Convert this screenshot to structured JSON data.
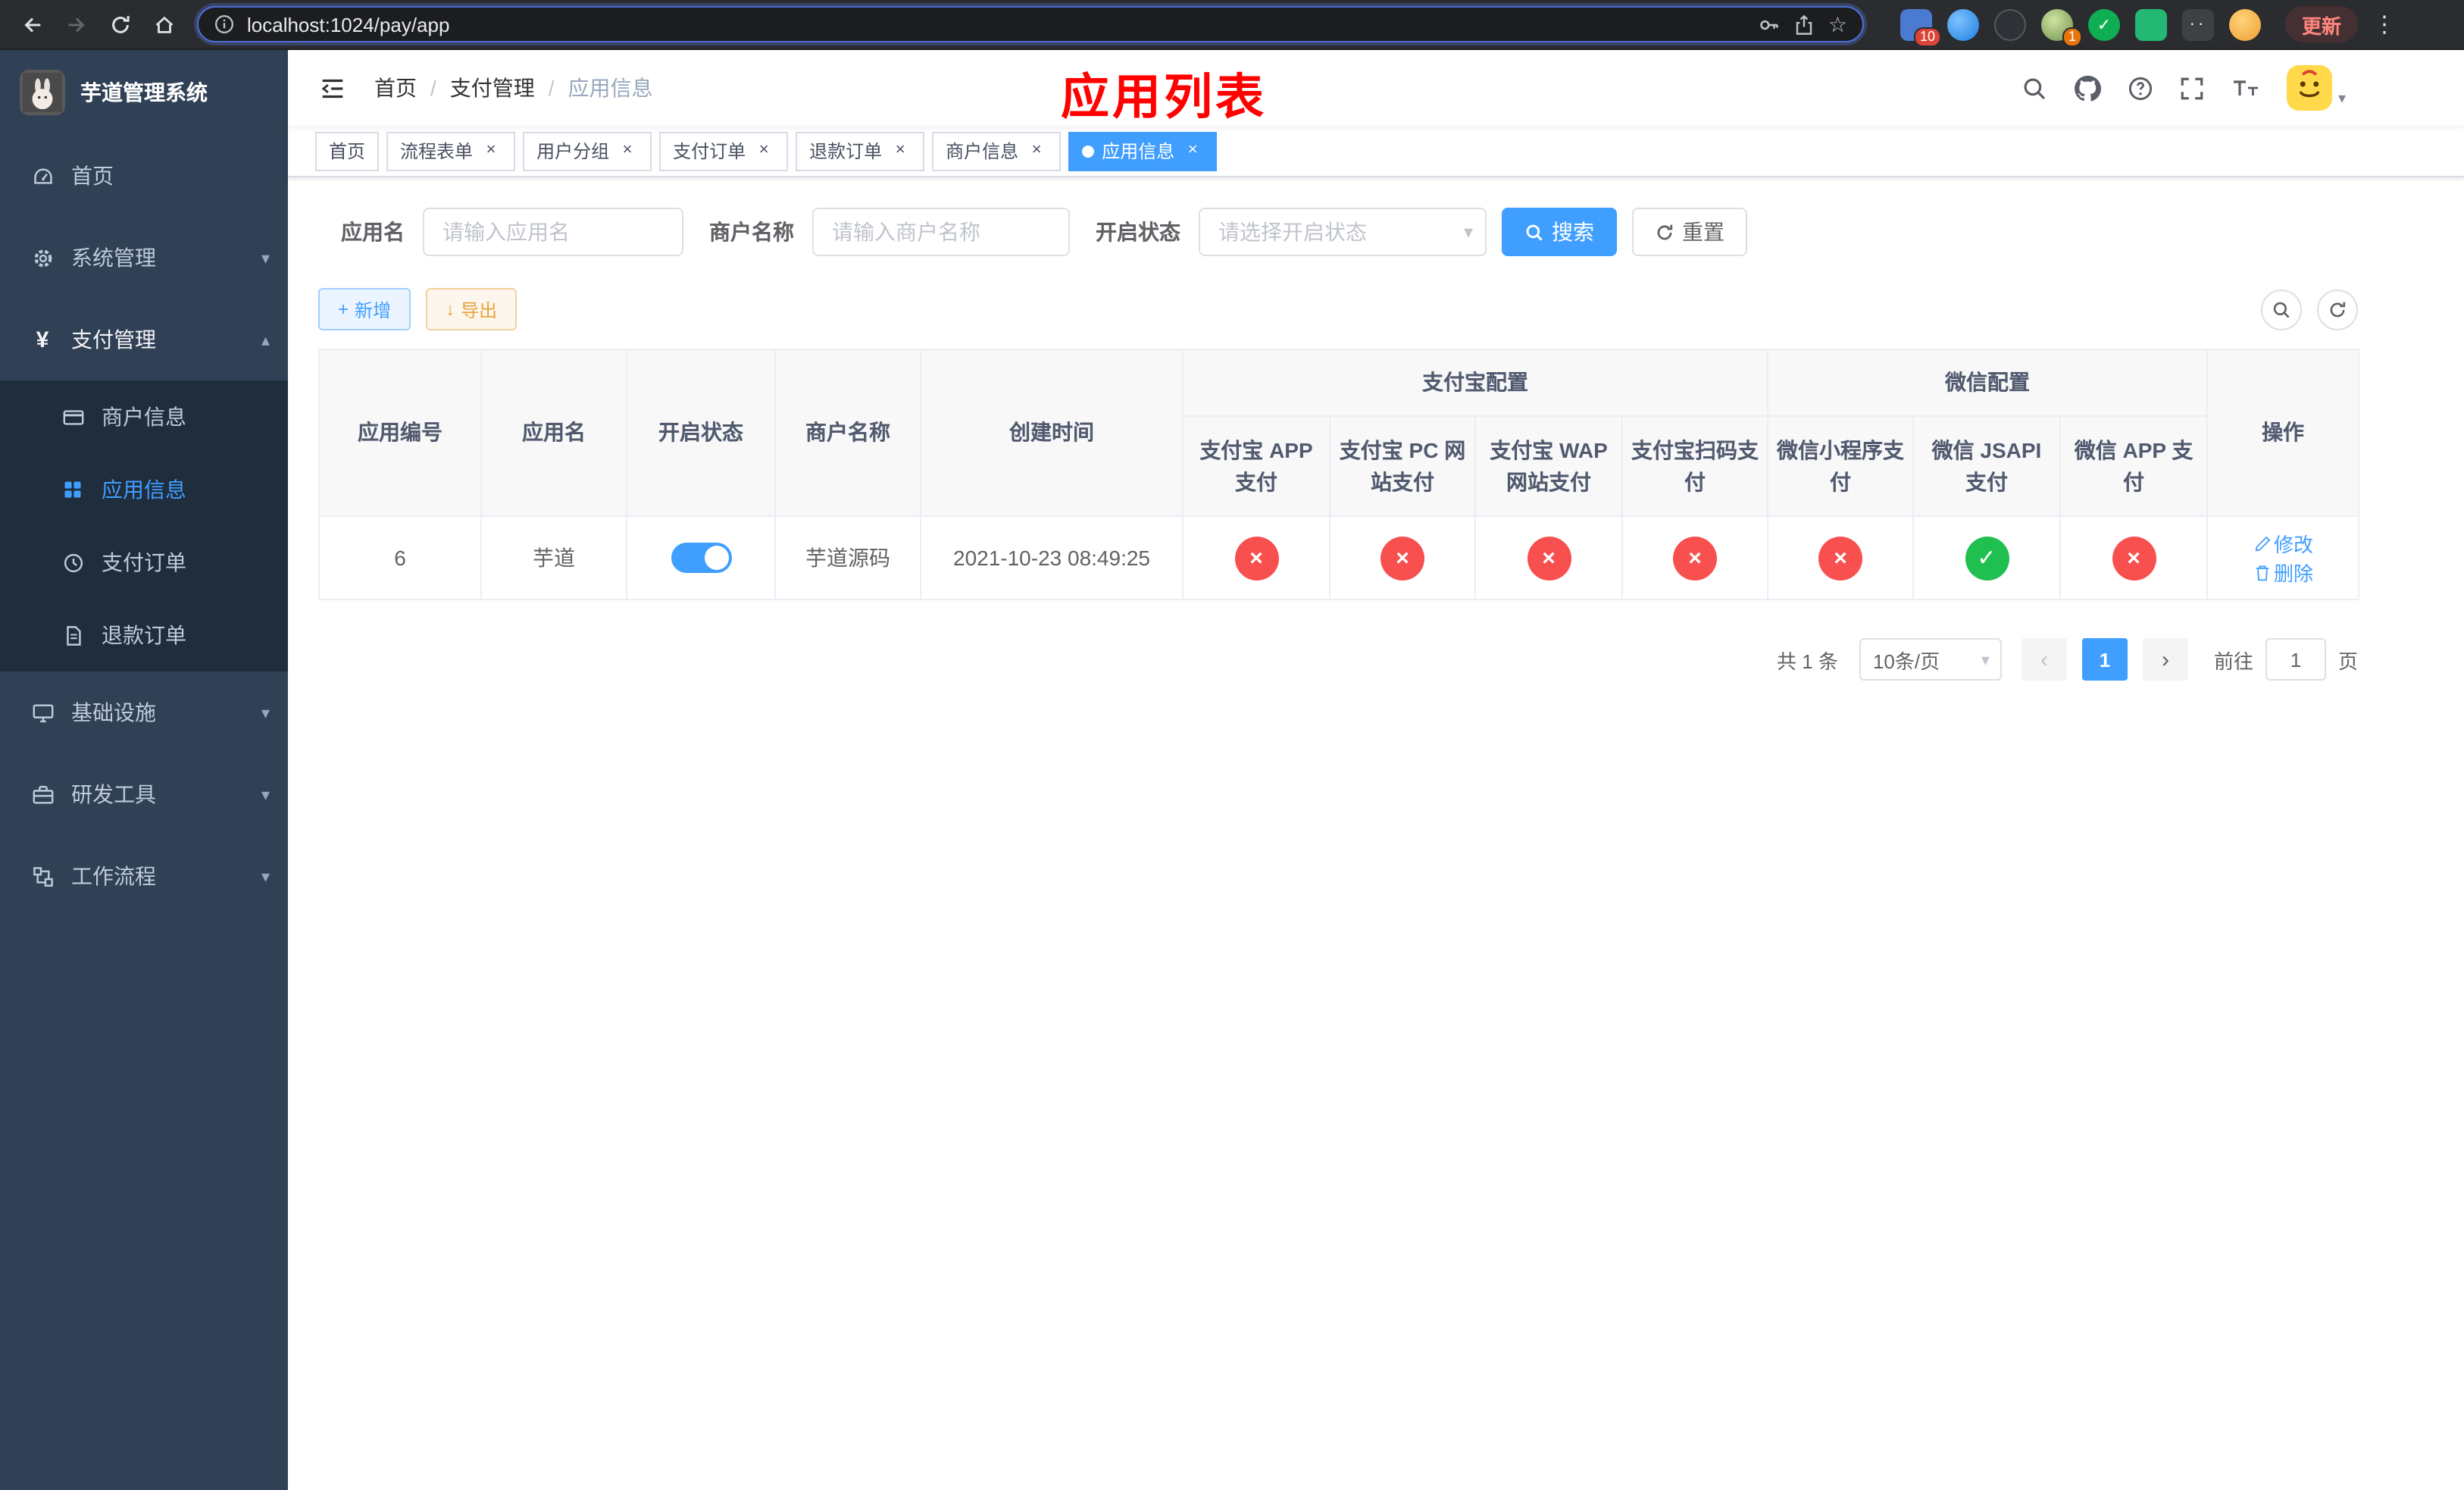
{
  "browser": {
    "url": "localhost:1024/pay/app",
    "update_label": "更新",
    "ext_badge_1": "10",
    "ext_badge_avatar": "1"
  },
  "icons": {
    "back": "←",
    "forward": "→",
    "star": "☆",
    "menu_dots": "⋮",
    "caret_down": "▾",
    "caret_up": "▴",
    "yen": "¥",
    "plus": "+",
    "download": "↓",
    "check": "✓",
    "cross": "×",
    "page_prev": "‹",
    "page_next": "›",
    "ext_check": "✓",
    "ext_eyes": "··"
  },
  "sidebar": {
    "app_title": "芋道管理系统",
    "items": {
      "home": "首页",
      "system": "系统管理",
      "payment": "支付管理",
      "merchant": "商户信息",
      "app_info": "应用信息",
      "pay_order": "支付订单",
      "refund_order": "退款订单",
      "infra": "基础设施",
      "dev_tools": "研发工具",
      "workflow": "工作流程"
    }
  },
  "header": {
    "breadcrumb": [
      "首页",
      "支付管理",
      "应用信息"
    ],
    "annotation": "应用列表"
  },
  "tabs": [
    {
      "label": "首页"
    },
    {
      "label": "流程表单"
    },
    {
      "label": "用户分组"
    },
    {
      "label": "支付订单"
    },
    {
      "label": "退款订单"
    },
    {
      "label": "商户信息"
    },
    {
      "label": "应用信息"
    }
  ],
  "filters": {
    "app_name": {
      "label": "应用名",
      "placeholder": "请输入应用名",
      "value": ""
    },
    "merchant_name": {
      "label": "商户名称",
      "placeholder": "请输入商户名称",
      "value": ""
    },
    "status": {
      "label": "开启状态",
      "placeholder": "请选择开启状态"
    },
    "search": "搜索",
    "reset": "重置"
  },
  "toolbar": {
    "add": "新增",
    "export": "导出"
  },
  "table": {
    "simple_columns": [
      "应用编号",
      "应用名",
      "开启状态",
      "商户名称",
      "创建时间"
    ],
    "alipay_group": "支付宝配置",
    "wechat_group": "微信配置",
    "alipay_columns": [
      "支付宝 APP 支付",
      "支付宝 PC 网站支付",
      "支付宝 WAP 网站支付",
      "支付宝扫码支付"
    ],
    "wechat_columns": [
      "微信小程序支付",
      "微信 JSAPI 支付",
      "微信 APP 支付"
    ],
    "actions_column": "操作",
    "rows": [
      {
        "id": "6",
        "name": "芋道",
        "enabled": true,
        "merchant_name": "芋道源码",
        "create_time": "2021-10-23 08:49:25",
        "alipay_app": false,
        "alipay_pc": false,
        "alipay_wap": false,
        "alipay_scan": false,
        "wechat_lite": false,
        "wechat_jsapi": true,
        "wechat_app": false,
        "edit": "修改",
        "delete": "删除"
      }
    ]
  },
  "pagination": {
    "total": "共 1 条",
    "page_size": "10条/页",
    "page": "1",
    "goto": "前往",
    "goto_value": "1",
    "unit": "页"
  },
  "colors": {
    "primary": "#409EFF",
    "danger": "#F7504F",
    "success": "#1FC050",
    "annotation_red": "#FE0100",
    "sidebar_bg": "#304156",
    "submenu_bg": "#1F2D3D"
  }
}
